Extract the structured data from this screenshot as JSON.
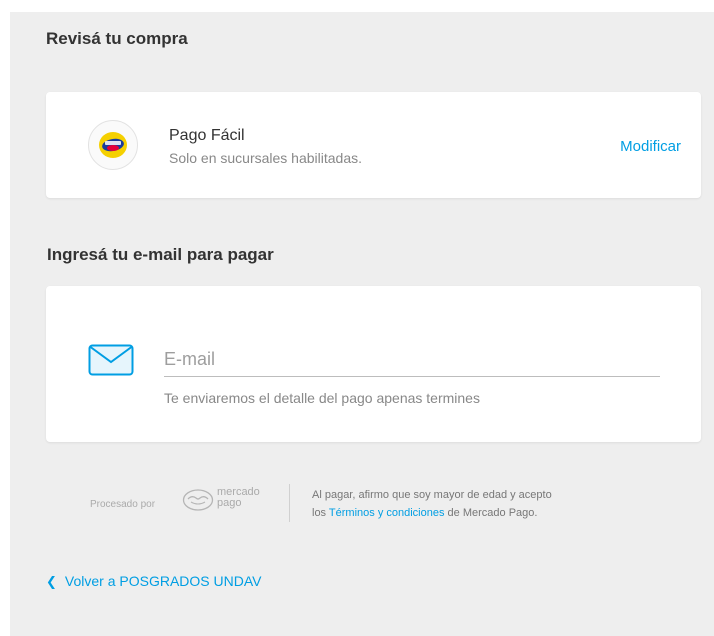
{
  "review": {
    "title": "Revisá tu compra",
    "payment_method": {
      "name": "Pago Fácil",
      "description": "Solo en sucursales habilitadas.",
      "modify_label": "Modificar",
      "logo_icon": "pago-facil-logo"
    }
  },
  "email_section": {
    "title": "Ingresá tu e-mail para pagar",
    "input": {
      "placeholder": "E-mail",
      "value": ""
    },
    "hint": "Te enviaremos el detalle del pago apenas termines",
    "icon": "mail-icon"
  },
  "footer": {
    "processed_by": "Procesado por",
    "brand_line1": "mercado",
    "brand_line2": "pago",
    "legal_prefix": "Al pagar, afirmo que soy mayor de edad y acepto",
    "legal_mid": "los",
    "terms_link": "Términos y condiciones",
    "legal_suffix": "de Mercado Pago."
  },
  "back_link": {
    "label": "Volver a POSGRADOS UNDAV",
    "icon": "chevron-left-icon"
  },
  "colors": {
    "accent": "#009ee3",
    "background": "#eeeeee",
    "card": "#ffffff"
  }
}
